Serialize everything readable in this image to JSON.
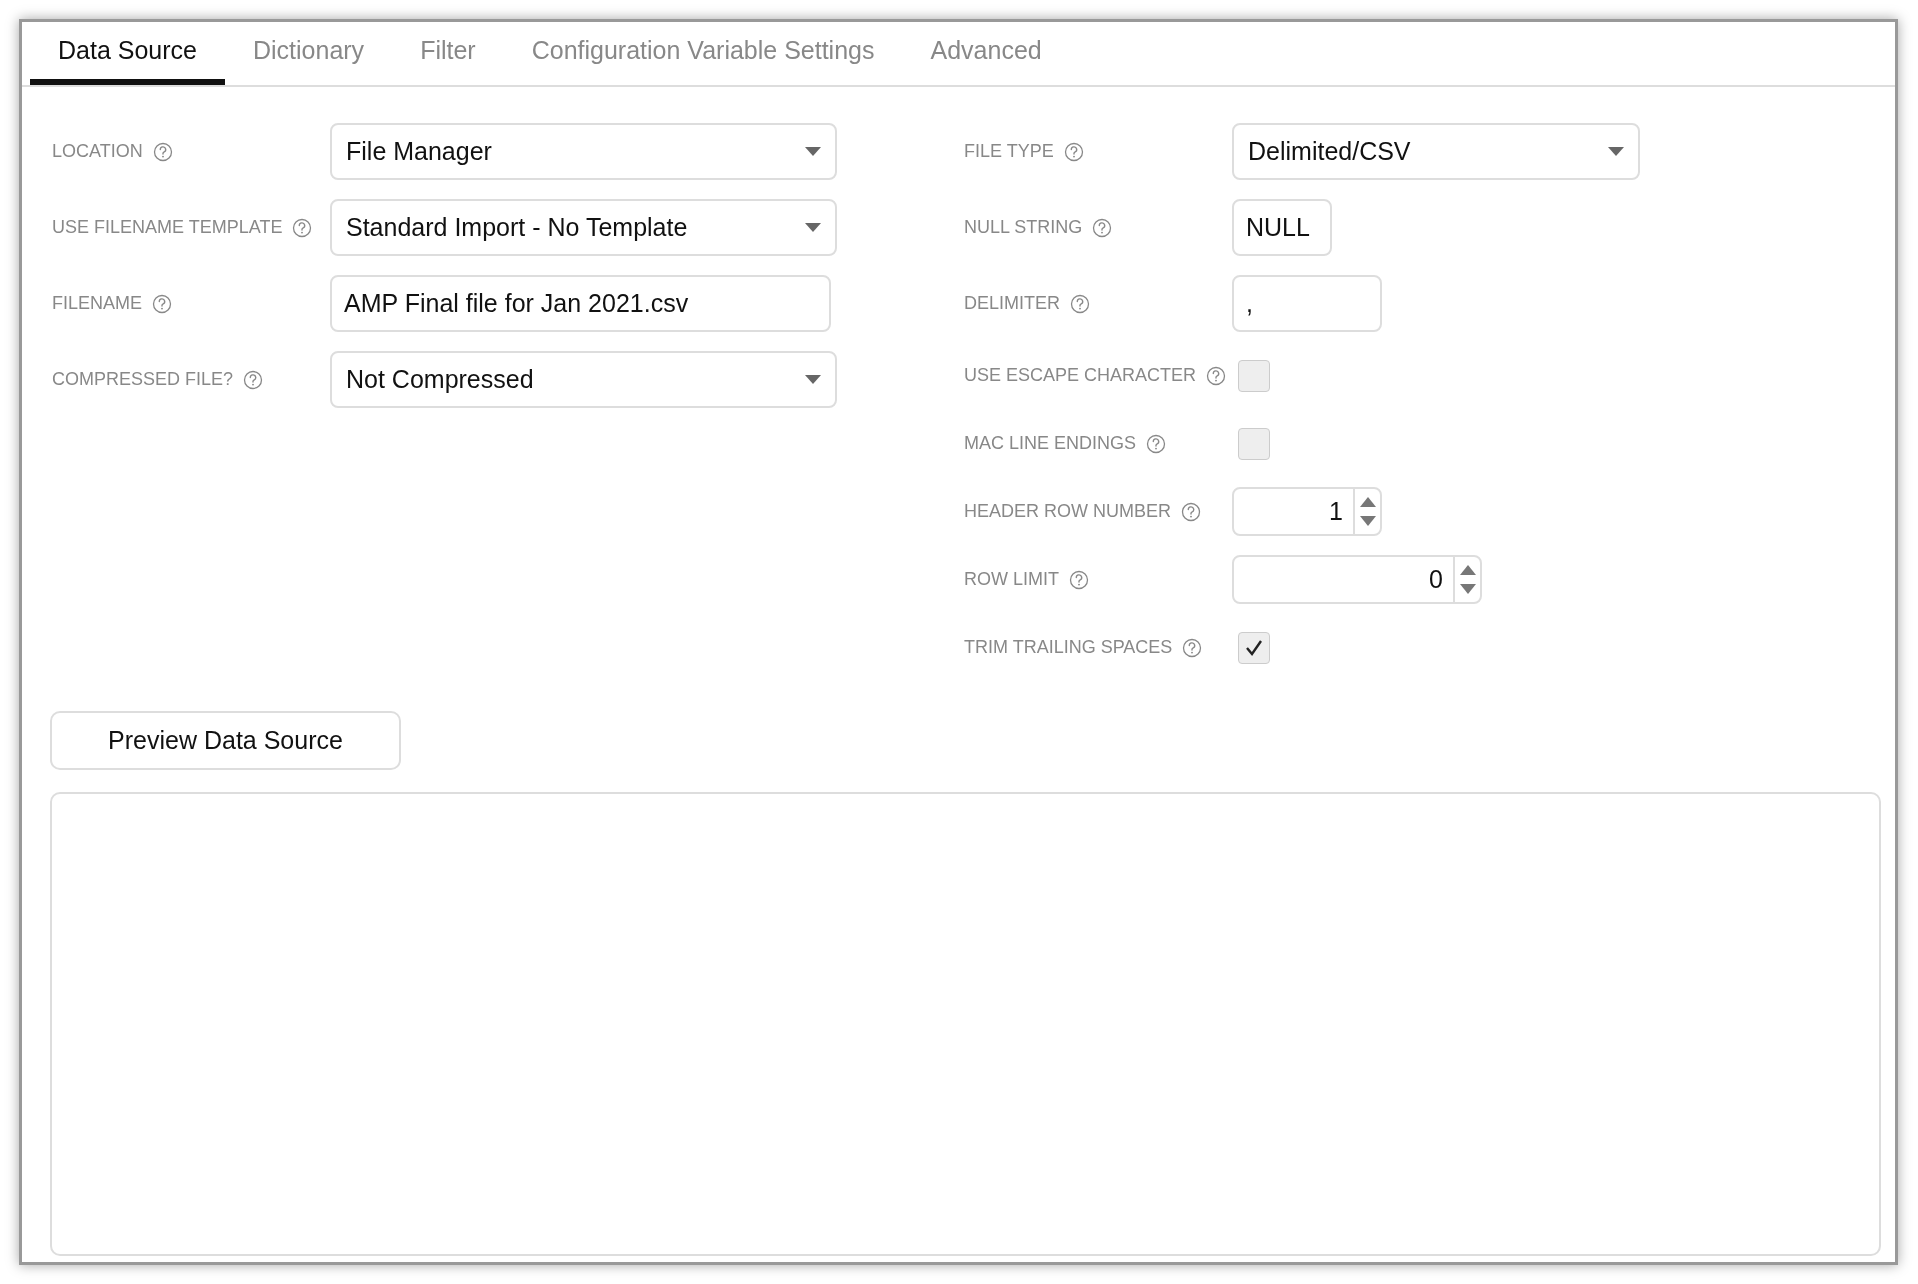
{
  "tabs": [
    {
      "label": "Data Source",
      "selected": true
    },
    {
      "label": "Dictionary",
      "selected": false
    },
    {
      "label": "Filter",
      "selected": false
    },
    {
      "label": "Configuration Variable Settings",
      "selected": false
    },
    {
      "label": "Advanced",
      "selected": false
    }
  ],
  "left_fields": [
    {
      "label": "LOCATION",
      "kind": "select",
      "value": "File Manager"
    },
    {
      "label": "USE FILENAME TEMPLATE",
      "kind": "select",
      "value": "Standard Import - No Template"
    },
    {
      "label": "FILENAME",
      "kind": "text",
      "value": "AMP Final file for Jan 2021.csv"
    },
    {
      "label": "COMPRESSED FILE?",
      "kind": "select",
      "value": "Not Compressed"
    }
  ],
  "right_fields": [
    {
      "label": "FILE TYPE",
      "kind": "select",
      "value": "Delimited/CSV"
    },
    {
      "label": "NULL STRING",
      "kind": "text",
      "value": "NULL"
    },
    {
      "label": "DELIMITER",
      "kind": "text",
      "value": ","
    },
    {
      "label": "USE ESCAPE CHARACTER",
      "kind": "checkbox",
      "checked": false
    },
    {
      "label": "MAC LINE ENDINGS",
      "kind": "checkbox",
      "checked": false
    },
    {
      "label": "HEADER ROW NUMBER",
      "kind": "spinner",
      "value": "1"
    },
    {
      "label": "ROW LIMIT",
      "kind": "spinner",
      "value": "0"
    },
    {
      "label": "TRIM TRAILING SPACES",
      "kind": "checkbox",
      "checked": true
    }
  ],
  "preview_button": "Preview Data Source"
}
